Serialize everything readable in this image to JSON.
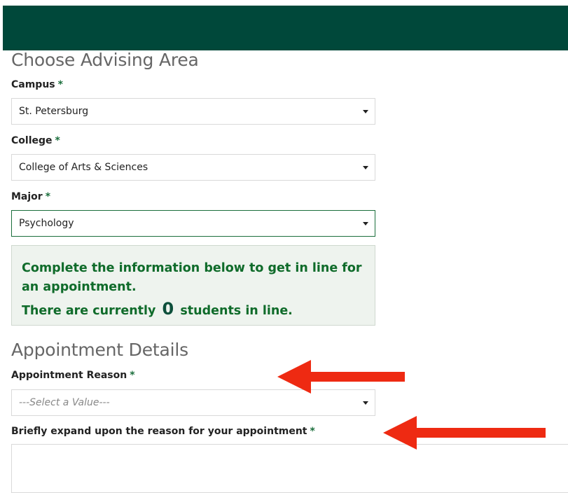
{
  "form": {
    "section1_title": "Choose Advising Area",
    "campus": {
      "label": "Campus",
      "required_mark": "*",
      "value": "St. Petersburg"
    },
    "college": {
      "label": "College",
      "required_mark": "*",
      "value": "College of Arts & Sciences"
    },
    "major": {
      "label": "Major",
      "required_mark": "*",
      "value": "Psychology"
    },
    "info": {
      "line1": "Complete the information below to get in line for an appointment.",
      "line2_prefix": "There are currently",
      "count": "0",
      "line2_suffix": "students in line."
    },
    "section2_title": "Appointment Details",
    "reason": {
      "label": "Appointment Reason",
      "required_mark": "*",
      "placeholder": "---Select a Value---"
    },
    "expand": {
      "label": "Briefly expand upon the reason for your appointment",
      "required_mark": "*",
      "value": ""
    }
  },
  "colors": {
    "header_bar": "#00483a",
    "accent_green": "#1b6e3c",
    "annotation_arrow": "#ee2a12"
  },
  "annotations": [
    "red-arrow",
    "red-arrow"
  ]
}
